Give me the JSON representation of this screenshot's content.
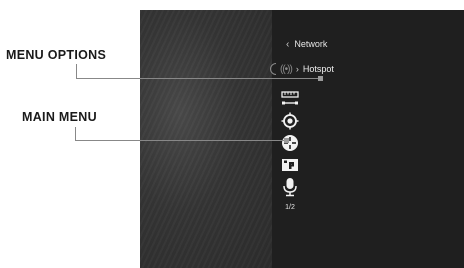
{
  "labels": {
    "menu_options": "MENU OPTIONS",
    "main_menu": "MAIN MENU"
  },
  "device": {
    "back_label": "Network",
    "back_icon": "chevron-left-icon",
    "current_item": {
      "label": "Hotspot",
      "icon": "wifi-broadcast-icon",
      "chevron": "chevron-right-icon"
    },
    "main_menu_icons": [
      "ruler-icon",
      "crosshair-target-icon",
      "reticle-icon",
      "camera-picture-icon",
      "microphone-icon"
    ],
    "page_indicator": "1/2"
  },
  "colors": {
    "screen_bg": "#2a2a2a",
    "menu_panel_bg": "#1f1f1f",
    "text_light": "#e6e6e6",
    "callout_text": "#1a1a1a",
    "leader_line": "#888888"
  }
}
